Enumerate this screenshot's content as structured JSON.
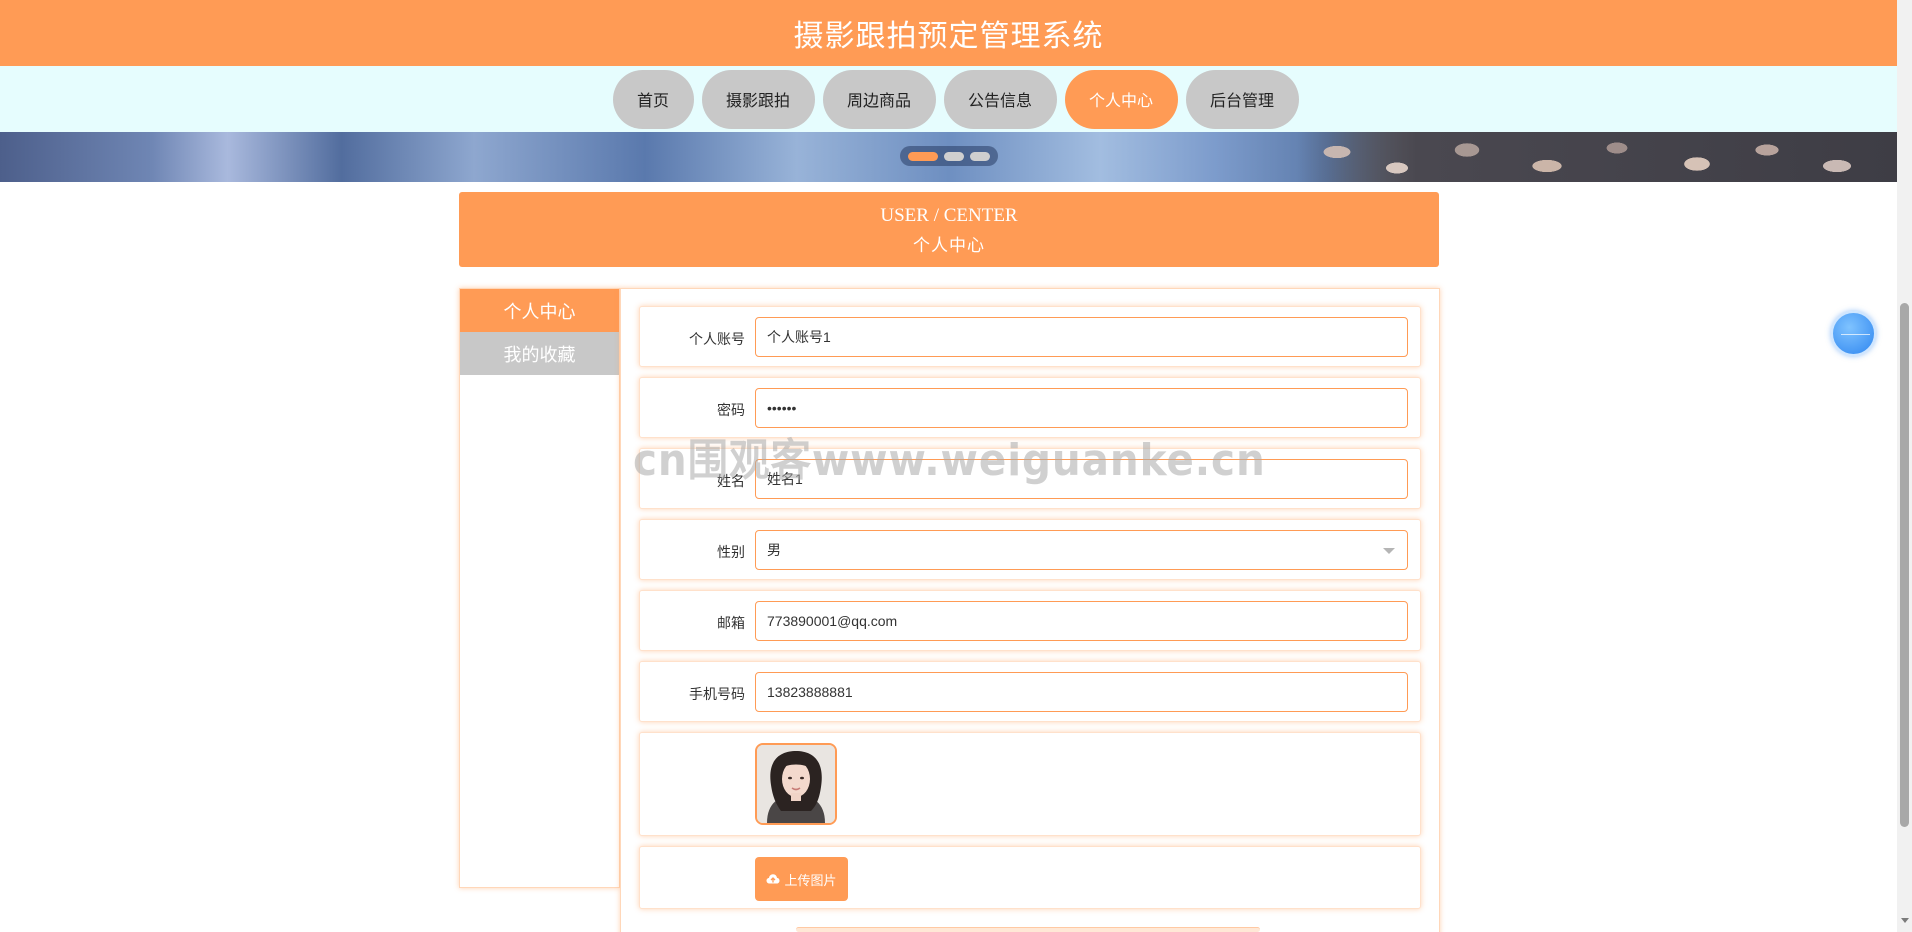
{
  "site": {
    "title": "摄影跟拍预定管理系统"
  },
  "nav": {
    "items": [
      {
        "label": "首页"
      },
      {
        "label": "摄影跟拍"
      },
      {
        "label": "周边商品"
      },
      {
        "label": "公告信息"
      },
      {
        "label": "个人中心",
        "active": true
      },
      {
        "label": "后台管理"
      }
    ]
  },
  "banner": {
    "slide_count": 3,
    "active_slide": 1
  },
  "heading": {
    "en": "USER / CENTER",
    "cn": "个人中心"
  },
  "sidebar": {
    "items": [
      {
        "label": "个人中心",
        "active": true
      },
      {
        "label": "我的收藏"
      }
    ]
  },
  "form": {
    "account": {
      "label": "个人账号",
      "value": "个人账号1"
    },
    "password": {
      "label": "密码",
      "value": "••••••"
    },
    "name": {
      "label": "姓名",
      "value": "姓名1"
    },
    "gender": {
      "label": "性别",
      "value": "男"
    },
    "email": {
      "label": "邮箱",
      "value": "773890001@qq.com"
    },
    "phone": {
      "label": "手机号码",
      "value": "13823888881"
    },
    "upload": {
      "label": "上传图片"
    }
  },
  "watermark": {
    "text": "cn围观客www.weiguanke.cn"
  },
  "colors": {
    "accent": "#ff9b55",
    "nav_bg": "#e6fdfe",
    "inactive": "#c8c8c8",
    "float_button": "#2f86f0"
  }
}
